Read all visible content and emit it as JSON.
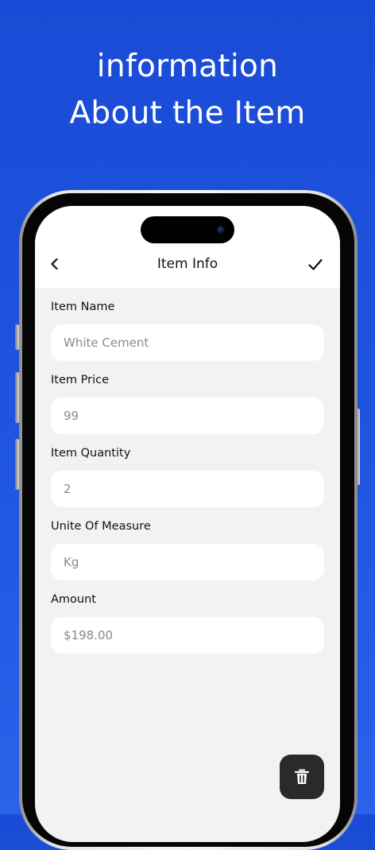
{
  "promo": {
    "line1": "information",
    "line2": "About the Item"
  },
  "nav": {
    "title": "Item Info",
    "back_icon": "chevron-left-icon",
    "confirm_icon": "checkmark-icon"
  },
  "form": {
    "fields": [
      {
        "label": "Item Name",
        "value": "White Cement"
      },
      {
        "label": "Item Price",
        "value": "99"
      },
      {
        "label": "Item Quantity",
        "value": "2"
      },
      {
        "label": "Unite Of Measure",
        "value": "Kg"
      },
      {
        "label": "Amount",
        "value": "$198.00"
      }
    ]
  },
  "actions": {
    "delete_icon": "trash-icon"
  },
  "colors": {
    "background": "#1f55df",
    "screen": "#f2f2f3",
    "delete_button": "#2a2a2c"
  }
}
